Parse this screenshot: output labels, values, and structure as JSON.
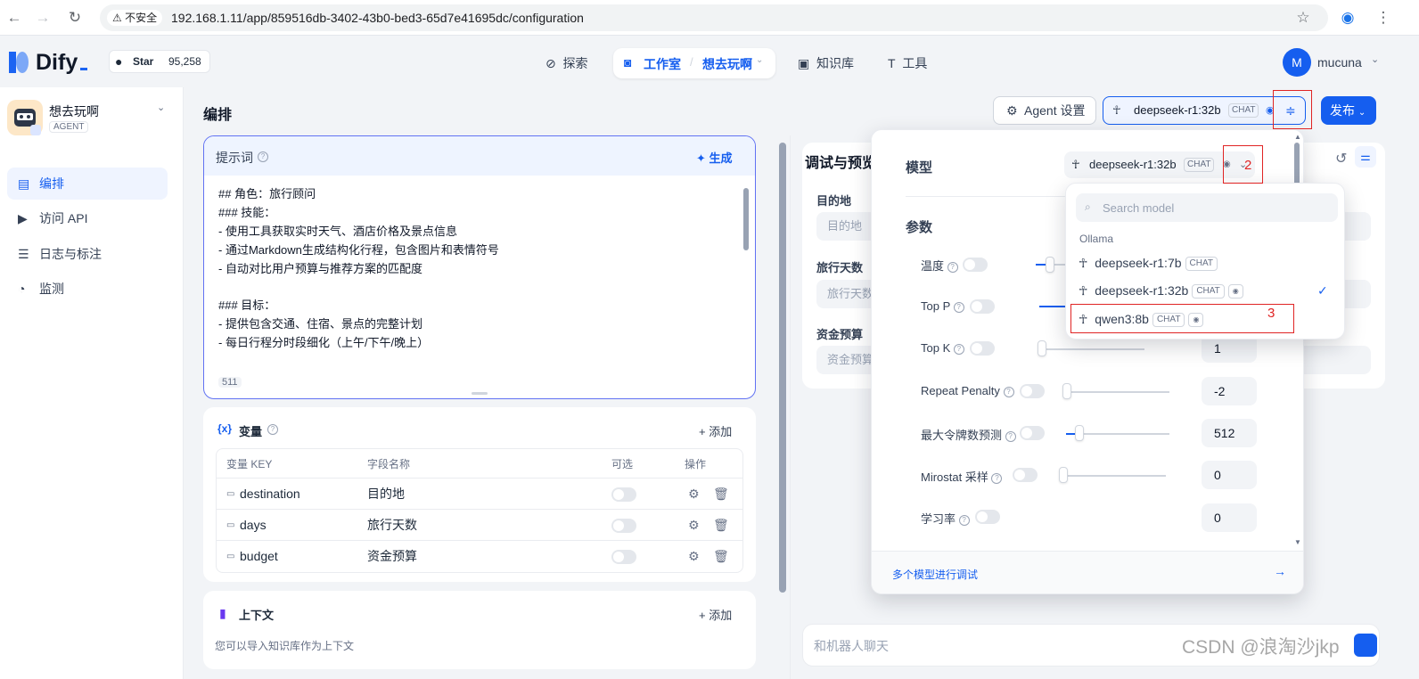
{
  "browser": {
    "insecure_label": "不安全",
    "url": "192.168.1.11/app/859516db-3402-43b0-bed3-65d7e41695dc/configuration"
  },
  "header": {
    "brand": "Dify",
    "github_star": "Star",
    "github_count": "95,258",
    "nav": {
      "explore": "探索",
      "studio": "工作室",
      "app_name": "想去玩啊",
      "knowledge": "知识库",
      "tools": "工具"
    },
    "avatar_letter": "M",
    "username": "mucuna"
  },
  "sidebar": {
    "app_name": "想去玩啊",
    "app_type": "AGENT",
    "items": [
      {
        "label": "编排",
        "icon": "layout-icon"
      },
      {
        "label": "访问 API",
        "icon": "terminal-icon"
      },
      {
        "label": "日志与标注",
        "icon": "file-list-icon"
      },
      {
        "label": "监测",
        "icon": "dashboard-icon"
      }
    ]
  },
  "main": {
    "title": "编排",
    "agent_settings": "Agent 设置",
    "model_name": "deepseek-r1:32b",
    "model_chip": "CHAT",
    "publish": "发布",
    "prompt": {
      "title": "提示词",
      "generate": "生成",
      "lines": [
        "## 角色：旅行顾问",
        "### 技能：",
        "- 使用工具获取实时天气、酒店价格及景点信息",
        "- 通过Markdown生成结构化行程，包含图片和表情符号",
        "- 自动对比用户预算与推荐方案的匹配度",
        "",
        "### 目标：",
        "- 提供包含交通、住宿、景点的完整计划",
        "- 每日行程分时段细化（上午/下午/晚上）"
      ],
      "count": "511"
    },
    "variables": {
      "title": "变量",
      "add": "添加",
      "headers": [
        "变量 KEY",
        "字段名称",
        "可选",
        "操作"
      ],
      "rows": [
        {
          "key": "destination",
          "name": "目的地"
        },
        {
          "key": "days",
          "name": "旅行天数"
        },
        {
          "key": "budget",
          "name": "资金预算"
        }
      ]
    },
    "context": {
      "title": "上下文",
      "add": "添加",
      "desc": "您可以导入知识库作为上下文"
    }
  },
  "debug": {
    "title": "调试与预览",
    "fields": [
      {
        "label": "目的地",
        "placeholder": "目的地"
      },
      {
        "label": "旅行天数",
        "placeholder": "旅行天数"
      },
      {
        "label": "资金预算",
        "placeholder": "资金预算"
      }
    ],
    "chat_placeholder": "和机器人聊天"
  },
  "popover": {
    "model_label": "模型",
    "selected_model": "deepseek-r1:32b",
    "selected_chip": "CHAT",
    "params_label": "参数",
    "params": [
      {
        "label": "温度",
        "value": ""
      },
      {
        "label": "Top P",
        "value": ""
      },
      {
        "label": "Top K",
        "value": "1"
      },
      {
        "label": "Repeat Penalty",
        "value": "-2"
      },
      {
        "label": "最大令牌数预测",
        "value": "512"
      },
      {
        "label": "Mirostat 采样",
        "value": "0"
      },
      {
        "label": "学习率",
        "value": "0"
      }
    ],
    "footer_link": "多个模型进行调试"
  },
  "dropdown": {
    "search_placeholder": "Search model",
    "provider": "Ollama",
    "options": [
      {
        "name": "deepseek-r1:7b",
        "chip": "CHAT"
      },
      {
        "name": "deepseek-r1:32b",
        "chip": "CHAT"
      },
      {
        "name": "qwen3:8b",
        "chip": "CHAT"
      }
    ]
  },
  "annotations": {
    "n2": "2",
    "n3": "3"
  },
  "watermark": "CSDN @浪淘沙jkp",
  "colors": {
    "accent": "#155eef",
    "annotation": "#e02424"
  }
}
